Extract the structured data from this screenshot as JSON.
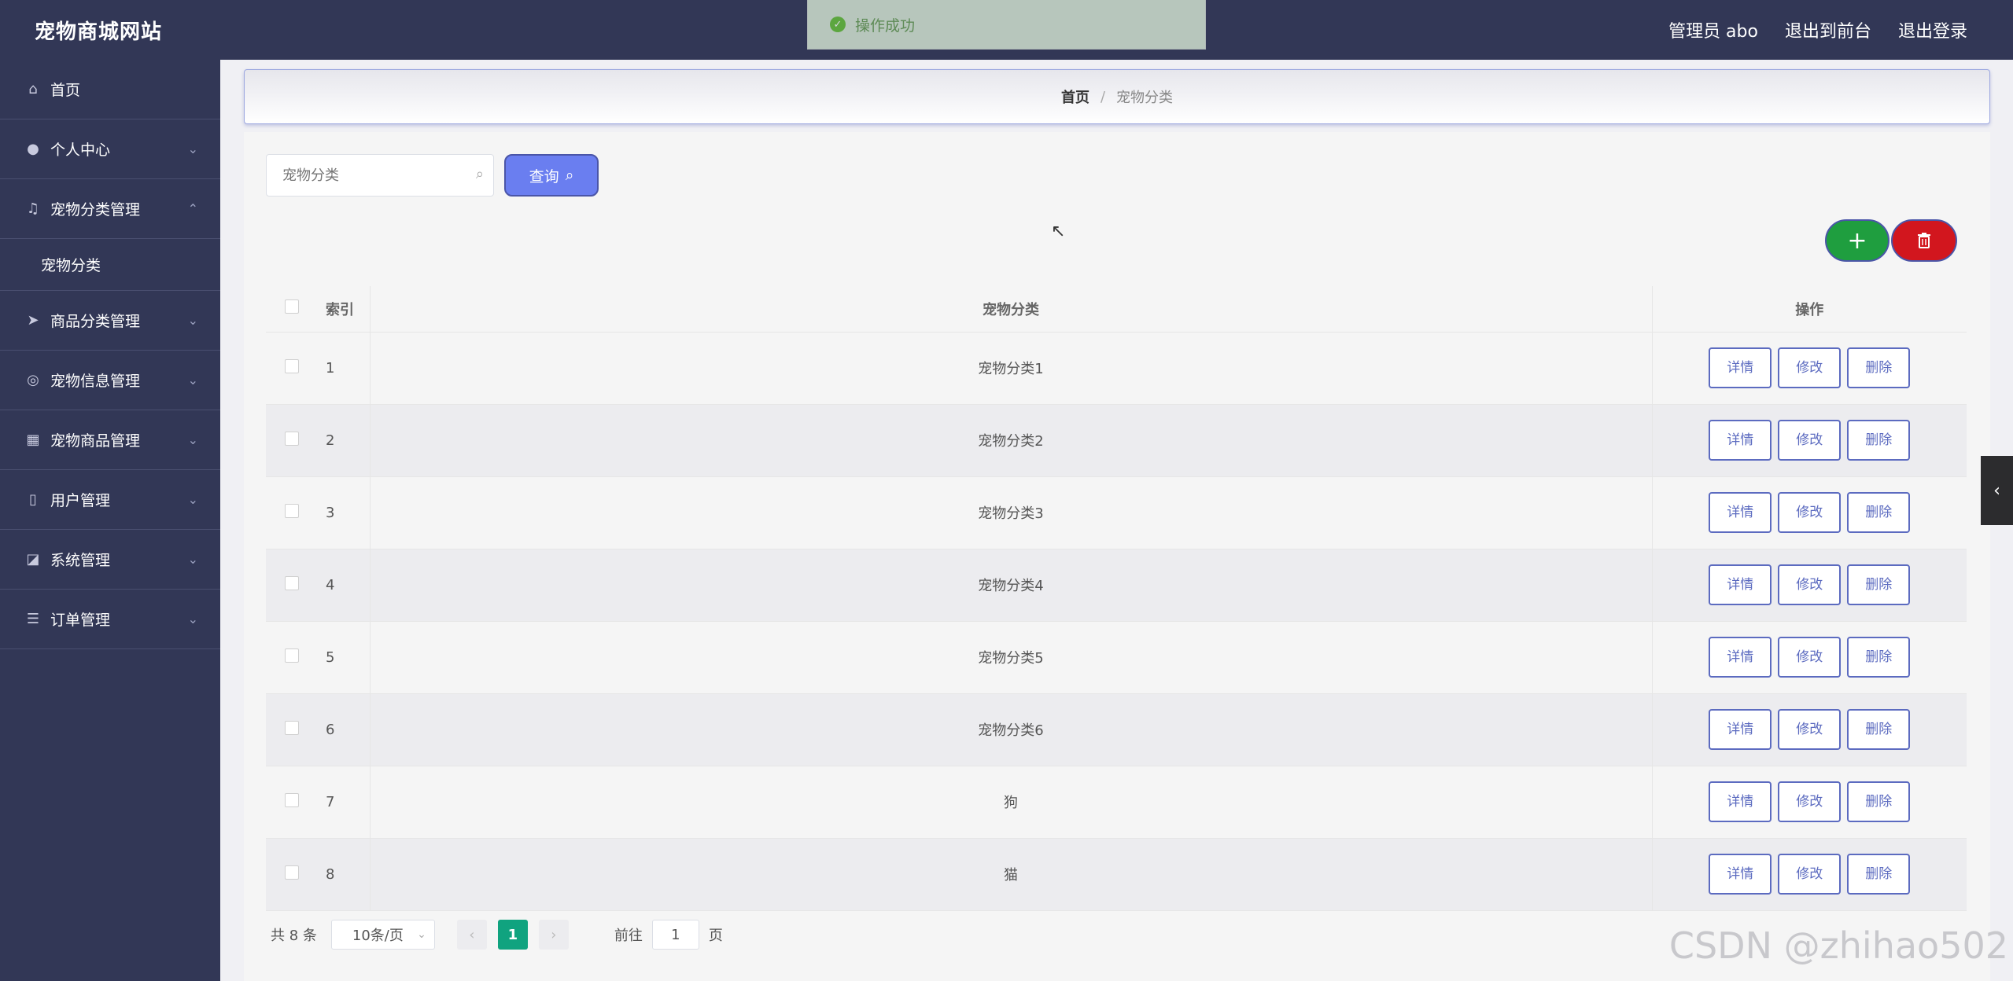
{
  "header": {
    "site_title": "宠物商城网站",
    "admin_label": "管理员 abo",
    "to_front": "退出到前台",
    "logout": "退出登录"
  },
  "toast": {
    "message": "操作成功"
  },
  "sidebar": {
    "items": [
      {
        "label": "首页",
        "icon": "home-icon",
        "chevron": ""
      },
      {
        "label": "个人中心",
        "icon": "user-icon",
        "chevron": "⌄"
      },
      {
        "label": "宠物分类管理",
        "icon": "bell-off-icon",
        "chevron": "⌃"
      },
      {
        "label": "商品分类管理",
        "icon": "send-icon",
        "chevron": "⌄"
      },
      {
        "label": "宠物信息管理",
        "icon": "compass-icon",
        "chevron": "⌄"
      },
      {
        "label": "宠物商品管理",
        "icon": "grid-icon",
        "chevron": "⌄"
      },
      {
        "label": "用户管理",
        "icon": "phone-icon",
        "chevron": "⌄"
      },
      {
        "label": "系统管理",
        "icon": "chart-icon",
        "chevron": "⌄"
      },
      {
        "label": "订单管理",
        "icon": "menu-icon",
        "chevron": "⌄"
      }
    ],
    "submenu_label": "宠物分类"
  },
  "breadcrumb": {
    "home": "首页",
    "sep": "/",
    "current": "宠物分类"
  },
  "search": {
    "placeholder": "宠物分类",
    "button": "查询"
  },
  "table": {
    "headers": {
      "index": "索引",
      "name": "宠物分类",
      "ops": "操作"
    },
    "rows": [
      {
        "idx": "1",
        "name": "宠物分类1"
      },
      {
        "idx": "2",
        "name": "宠物分类2"
      },
      {
        "idx": "3",
        "name": "宠物分类3"
      },
      {
        "idx": "4",
        "name": "宠物分类4"
      },
      {
        "idx": "5",
        "name": "宠物分类5"
      },
      {
        "idx": "6",
        "name": "宠物分类6"
      },
      {
        "idx": "7",
        "name": "狗"
      },
      {
        "idx": "8",
        "name": "猫"
      }
    ],
    "ops": {
      "detail": "详情",
      "edit": "修改",
      "delete": "删除"
    }
  },
  "pager": {
    "total": "共 8 条",
    "page_size": "10条/页",
    "current_page": "1",
    "goto_prefix": "前往",
    "goto_value": "1",
    "goto_suffix": "页"
  },
  "watermark": "CSDN @zhihao502",
  "colors": {
    "nav_bg": "#323756",
    "primary": "#6a7ef0",
    "add": "#1f9e3f",
    "delete": "#d2161e",
    "page_active": "#10a37f"
  }
}
